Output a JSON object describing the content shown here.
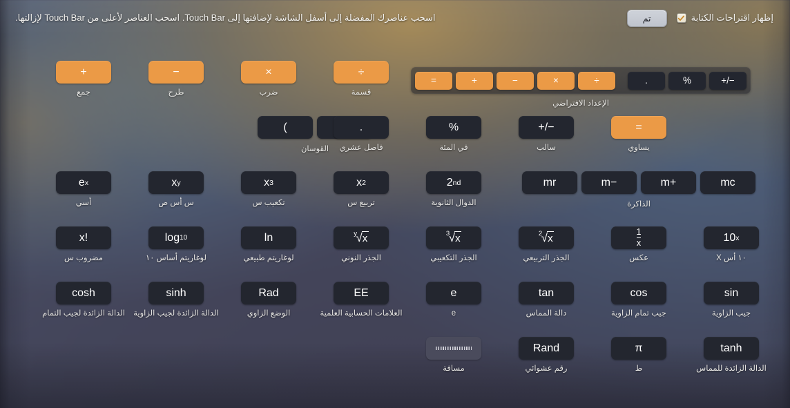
{
  "header": {
    "done_label": "تم",
    "checkbox_label": "إظهار اقتراحات الكتابة",
    "checkbox_checked": true,
    "instruction": "اسحب عناصرك المفضلة إلى أسفل الشاشة لإضافتها إلى Touch Bar. اسحب العناصر لأعلى من Touch Bar لإزالتها."
  },
  "touchbar": {
    "label": "الإعداد الافتراضي",
    "left_keys": [
      {
        "glyph": "=",
        "style": "orange",
        "name": "equals"
      },
      {
        "glyph": "+",
        "style": "orange",
        "name": "plus"
      },
      {
        "glyph": "−",
        "style": "orange",
        "name": "minus"
      },
      {
        "glyph": "×",
        "style": "orange",
        "name": "multiply"
      },
      {
        "glyph": "÷",
        "style": "orange",
        "name": "divide"
      }
    ],
    "right_keys": [
      {
        "glyph": ".",
        "style": "dark",
        "name": "decimal-point"
      },
      {
        "glyph": "%",
        "style": "dark",
        "name": "percent"
      },
      {
        "glyph": "+/−",
        "style": "dark",
        "name": "sign-toggle"
      }
    ]
  },
  "colors": {
    "accent_orange": "#eb9a46",
    "key_dark": "#23262f",
    "spacer_gray": "#4a4b5c",
    "text": "#e7e6e3"
  },
  "rows": [
    {
      "items": [
        {
          "kind": "key",
          "name": "addition",
          "glyph": "+",
          "style": "orange",
          "label": "جمع"
        },
        {
          "kind": "key",
          "name": "subtraction",
          "glyph": "−",
          "style": "orange",
          "label": "طرح"
        },
        {
          "kind": "key",
          "name": "multiplication",
          "glyph": "×",
          "style": "orange",
          "label": "ضرب"
        },
        {
          "kind": "key",
          "name": "division",
          "glyph": "÷",
          "style": "orange",
          "label": "قسمة"
        }
      ]
    },
    {
      "items": [
        {
          "kind": "cluster",
          "name": "parentheses",
          "label": "القوسان",
          "keys": [
            {
              "name": "open-paren",
              "glyph": "(",
              "style": "dark"
            },
            {
              "name": "close-paren",
              "glyph": ")",
              "style": "dark"
            }
          ]
        },
        {
          "kind": "key",
          "name": "decimal-point",
          "glyph": ".",
          "style": "dark",
          "label": "فاصل عشري"
        },
        {
          "kind": "key",
          "name": "percent",
          "glyph": "%",
          "style": "dark",
          "label": "في المئة"
        },
        {
          "kind": "key",
          "name": "sign-toggle",
          "glyph": "+/−",
          "style": "dark",
          "label": "سالب"
        },
        {
          "kind": "key",
          "name": "equals",
          "glyph": "=",
          "style": "orange",
          "label": "يساوي"
        }
      ]
    },
    {
      "items": [
        {
          "kind": "key",
          "name": "e-to-the-x",
          "glyph": "e",
          "sup": "x",
          "style": "dark",
          "label": "أسي"
        },
        {
          "kind": "key",
          "name": "x-to-the-y",
          "glyph": "x",
          "sup": "y",
          "style": "dark",
          "label": "س أس ص"
        },
        {
          "kind": "key",
          "name": "x-cubed",
          "glyph": "x",
          "sup": "3",
          "style": "dark",
          "label": "تكعيب س"
        },
        {
          "kind": "key",
          "name": "x-squared",
          "glyph": "x",
          "sup": "2",
          "style": "dark",
          "label": "تربيع س"
        },
        {
          "kind": "key",
          "name": "second-functions",
          "glyph": "2",
          "sup": "nd",
          "style": "dark",
          "label": "الدوال الثانوية"
        },
        {
          "kind": "cluster",
          "name": "memory",
          "label": "الذاكرة",
          "keys": [
            {
              "name": "memory-recall",
              "glyph": "mr",
              "style": "dark"
            },
            {
              "name": "memory-subtract",
              "glyph": "m−",
              "style": "dark"
            },
            {
              "name": "memory-add",
              "glyph": "m+",
              "style": "dark"
            },
            {
              "name": "memory-clear",
              "glyph": "mc",
              "style": "dark"
            }
          ]
        }
      ]
    },
    {
      "items": [
        {
          "kind": "key",
          "name": "factorial",
          "glyph": "x!",
          "style": "dark",
          "label": "مضروب س"
        },
        {
          "kind": "key",
          "name": "log-base-10",
          "glyph": "log",
          "sub": "10",
          "style": "dark",
          "label": "لوغاريتم أساس ١٠"
        },
        {
          "kind": "key",
          "name": "natural-log",
          "glyph": "ln",
          "style": "dark",
          "label": "لوغاريتم طبيعي"
        },
        {
          "kind": "radical",
          "name": "nth-root",
          "index": "y",
          "arg": "x",
          "style": "dark",
          "label": "الجذر النوني"
        },
        {
          "kind": "radical",
          "name": "cube-root",
          "index": "3",
          "arg": "x",
          "style": "dark",
          "label": "الجذر التكعيبي"
        },
        {
          "kind": "radical",
          "name": "square-root",
          "index": "2",
          "arg": "x",
          "style": "dark",
          "label": "الجذر التربيعي"
        },
        {
          "kind": "fraction",
          "name": "reciprocal",
          "num": "1",
          "den": "x",
          "style": "dark",
          "label": "عكس"
        },
        {
          "kind": "key",
          "name": "ten-to-the-x",
          "glyph": "10",
          "sup": "x",
          "style": "dark",
          "label": "١٠ أس X"
        }
      ]
    },
    {
      "items": [
        {
          "kind": "key",
          "name": "cosh",
          "glyph": "cosh",
          "style": "dark",
          "label": "الدالة الزائدة لجيب التمام"
        },
        {
          "kind": "key",
          "name": "sinh",
          "glyph": "sinh",
          "style": "dark",
          "label": "الدالة الزائدة لجيب الزاوية"
        },
        {
          "kind": "key",
          "name": "angle-mode-rad",
          "glyph": "Rad",
          "style": "dark",
          "label": "الوضع الزاوي"
        },
        {
          "kind": "key",
          "name": "scientific-notation",
          "glyph": "EE",
          "style": "dark",
          "label": "العلامات الحسابية العلمية"
        },
        {
          "kind": "key",
          "name": "euler-number",
          "glyph": "e",
          "style": "dark",
          "label": "e"
        },
        {
          "kind": "key",
          "name": "tangent",
          "glyph": "tan",
          "style": "dark",
          "label": "دالة المماس"
        },
        {
          "kind": "key",
          "name": "cosine",
          "glyph": "cos",
          "style": "dark",
          "label": "جيب تمام الزاوية"
        },
        {
          "kind": "key",
          "name": "sine",
          "glyph": "sin",
          "style": "dark",
          "label": "جيب الزاوية"
        }
      ]
    },
    {
      "items": [
        {
          "kind": "spacer",
          "name": "spacer",
          "style": "spacer",
          "label": "مسافة"
        },
        {
          "kind": "key",
          "name": "random",
          "glyph": "Rand",
          "style": "dark",
          "label": "رقم عشوائي"
        },
        {
          "kind": "key",
          "name": "pi",
          "glyph": "π",
          "style": "dark",
          "label": "ط"
        },
        {
          "kind": "key",
          "name": "tanh",
          "glyph": "tanh",
          "style": "dark",
          "label": "الدالة الزائدة للمماس"
        }
      ]
    }
  ]
}
